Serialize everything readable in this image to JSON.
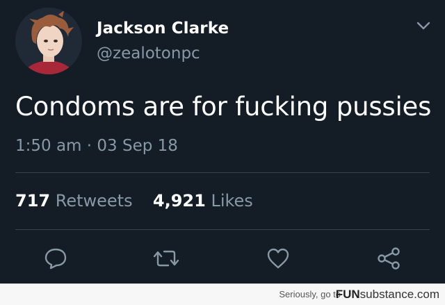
{
  "author": {
    "display_name": "Jackson Clarke",
    "handle": "@zealotonpc"
  },
  "tweet": {
    "text": "Condoms are for fucking pussies",
    "timestamp": "1:50 am · 03 Sep 18"
  },
  "stats": {
    "retweets_count": "717",
    "retweets_label": "Retweets",
    "likes_count": "4,921",
    "likes_label": "Likes"
  },
  "actions": [
    {
      "icon": "reply-icon"
    },
    {
      "icon": "retweet-icon"
    },
    {
      "icon": "like-icon"
    },
    {
      "icon": "share-icon"
    }
  ],
  "footer": {
    "tagline": "Seriously, go to",
    "brand_bold": "FUN",
    "brand_rest": "substance.com"
  },
  "colors": {
    "background": "#141d26",
    "text_primary": "#ffffff",
    "text_secondary": "#8899a6",
    "divider": "#38444d"
  }
}
